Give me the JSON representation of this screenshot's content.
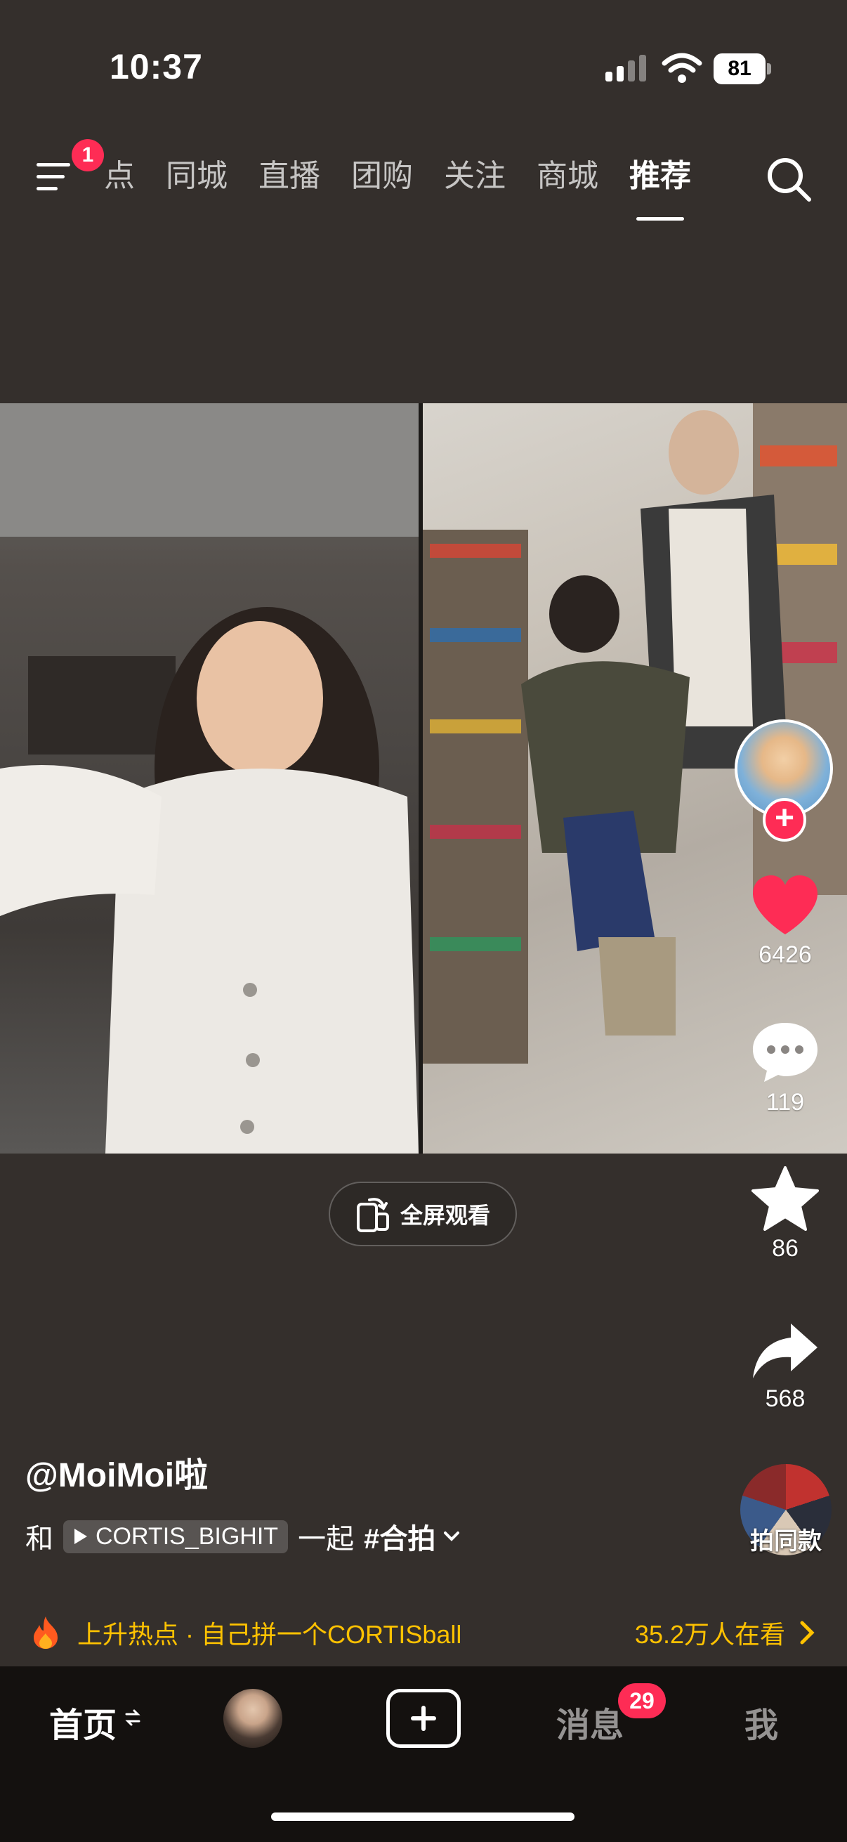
{
  "status_bar": {
    "time": "10:37",
    "battery": "81"
  },
  "top_nav": {
    "menu_badge": "1",
    "tabs": [
      "点",
      "同城",
      "直播",
      "团购",
      "关注",
      "商城",
      "推荐"
    ],
    "active_tab": "推荐"
  },
  "actions": {
    "likes": "6426",
    "comments": "119",
    "favorites": "86",
    "shares": "568",
    "same_style_label": "拍同款"
  },
  "fullscreen_label": "全屏观看",
  "post": {
    "username": "@MoiMoi啦",
    "prefix": "和",
    "duet_partner": "CORTIS_BIGHIT",
    "together": "一起",
    "hashtag": "#合拍"
  },
  "hot": {
    "text": "上升热点 · 自己拼一个CORTISball",
    "viewers": "35.2万人在看"
  },
  "tab_bar": {
    "home": "首页",
    "messages": "消息",
    "messages_badge": "29",
    "me": "我"
  },
  "colors": {
    "accent": "#fe2c55",
    "hot": "#ffc200",
    "background": "#342f2c"
  },
  "icons": [
    "menu-icon",
    "search-icon",
    "heart-icon",
    "comment-icon",
    "star-icon",
    "share-icon",
    "fire-icon",
    "plus-icon"
  ]
}
